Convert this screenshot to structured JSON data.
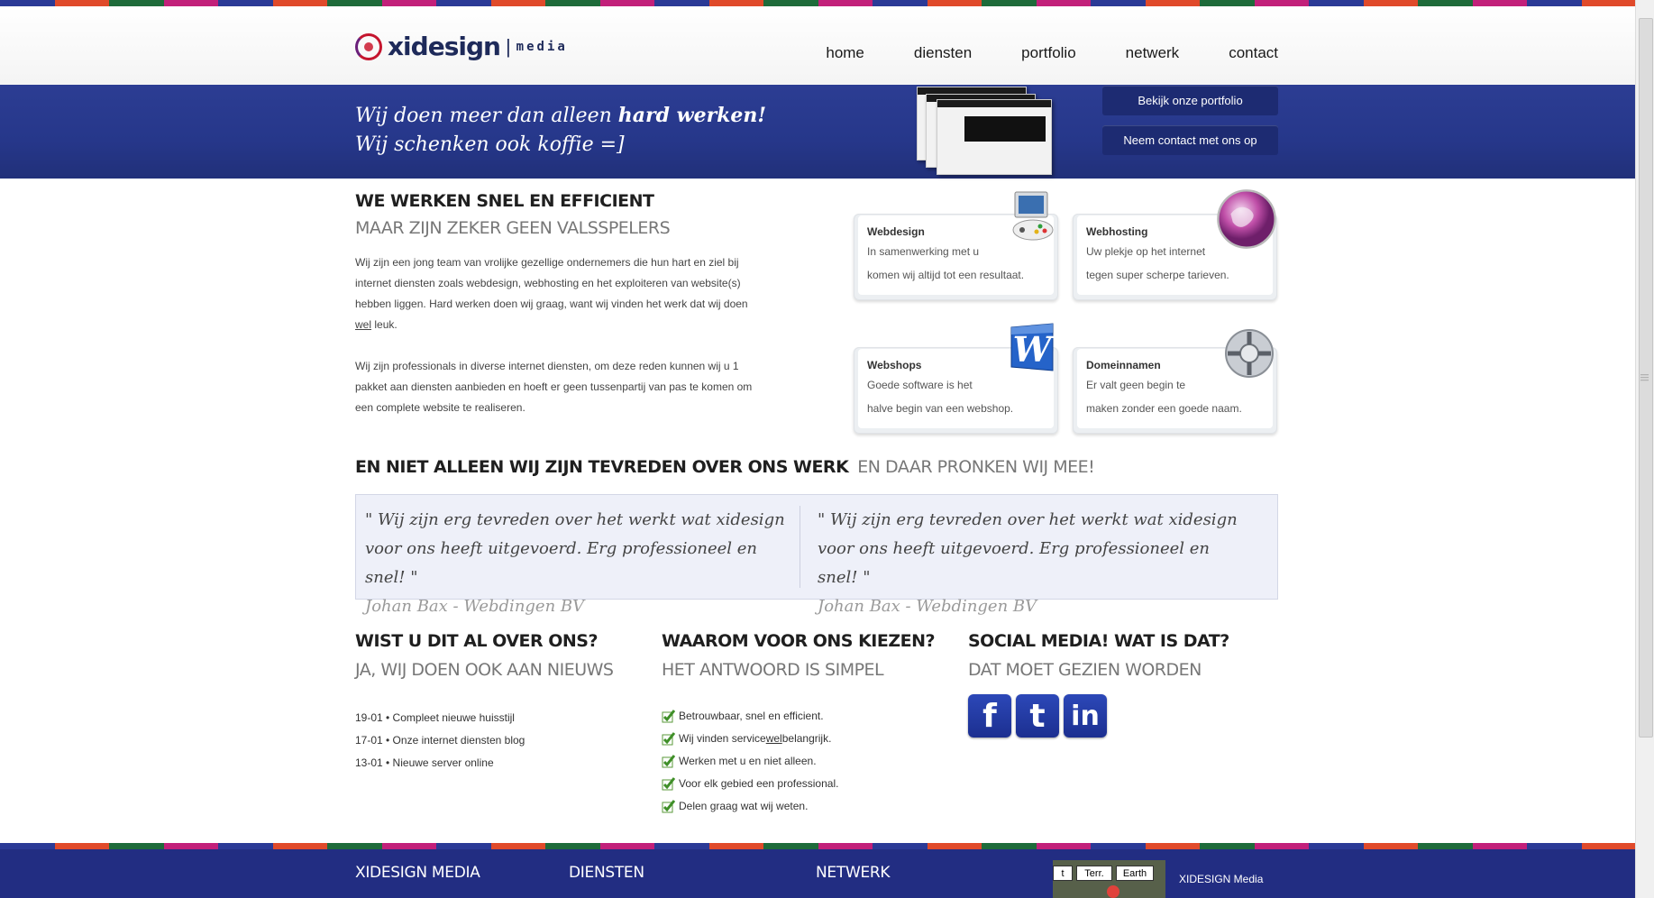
{
  "colors": {
    "brand_blue": "#26378a",
    "button_blue": "#1d2b72",
    "footer_blue": "#222d82",
    "stripe": [
      "#2b3a96",
      "#e04a2a",
      "#1e6b3a",
      "#c2207a",
      "#2b3a96",
      "#e04a2a",
      "#1e6b3a",
      "#c2207a",
      "#2b3a96",
      "#e04a2a",
      "#1e6b3a",
      "#c2207a",
      "#2b3a96",
      "#e04a2a",
      "#1e6b3a",
      "#c2207a",
      "#2b3a96",
      "#e04a2a",
      "#1e6b3a",
      "#c2207a",
      "#2b3a96",
      "#e04a2a",
      "#1e6b3a",
      "#c2207a",
      "#2b3a96",
      "#e04a2a",
      "#1e6b3a",
      "#c2207a",
      "#2b3a96",
      "#e04a2a"
    ]
  },
  "header": {
    "logo_name": "xidesign",
    "logo_sep": "|",
    "logo_sub": "media",
    "nav": [
      "home",
      "diensten",
      "portfolio",
      "netwerk",
      "contact"
    ]
  },
  "banner": {
    "line1_pre": "Wij doen meer dan alleen ",
    "line1_bold": "hard werken!",
    "line2": "Wij schenken ook koffie =]",
    "btn_portfolio": "Bekijk onze portfolio",
    "btn_contact": "Neem contact met ons op"
  },
  "intro": {
    "title": "WE WERKEN SNEL EN EFFICIENT",
    "subtitle": "MAAR ZIJN ZEKER GEEN VALSSPELERS",
    "p1_a": "Wij zijn een jong team van vrolijke gezellige ondernemers die hun hart en ziel bij internet diensten zoals webdesign, webhosting en het exploiteren van website(s) hebben liggen. Hard werken doen wij graag, want wij vinden het werk dat wij doen ",
    "p1_u": "wel",
    "p1_b": " leuk.",
    "p2": "Wij zijn professionals in diverse internet diensten, om deze reden kunnen wij u 1 pakket aan diensten aanbieden en hoeft er geen tussenpartij van pas te komen om een complete website te realiseren."
  },
  "services": [
    {
      "title": "Webdesign",
      "line1": "In samenwerking met u",
      "line2": "komen wij altijd tot een resultaat.",
      "icon": "gamepad-monitor-icon"
    },
    {
      "title": "Webhosting",
      "line1": "Uw plekje op het internet",
      "line2": "tegen super scherpe tarieven.",
      "icon": "globe-icon"
    },
    {
      "title": "Webshops",
      "line1": "Goede software is het",
      "line2": "halve begin van een webshop.",
      "icon": "word-w-icon"
    },
    {
      "title": "Domeinnamen",
      "line1": "Er valt geen begin te",
      "line2": "maken zonder een goede naam.",
      "icon": "network-hub-icon"
    }
  ],
  "testimonials": {
    "title": "EN NIET ALLEEN WIJ ZIJN TEVREDEN OVER ONS WERK",
    "subtitle": "EN DAAR PRONKEN WIJ MEE!",
    "items": [
      {
        "text": "\" Wij zijn erg tevreden over het werkt wat xidesign voor ons heeft uitgevoerd. Erg professioneel en snel! \"",
        "by": "Johan Bax - Webdingen BV"
      },
      {
        "text": "\" Wij zijn erg tevreden over het werkt wat xidesign voor ons heeft uitgevoerd. Erg professioneel en snel! \"",
        "by": "Johan Bax - Webdingen BV"
      }
    ]
  },
  "news": {
    "title": "WIST U DIT AL OVER ONS?",
    "subtitle": "JA, WIJ DOEN OOK AAN NIEUWS",
    "items": [
      "19-01 • Compleet nieuwe huisstijl",
      "17-01 • Onze internet diensten blog",
      "13-01 • Nieuwe server online"
    ]
  },
  "why": {
    "title": "WAAROM VOOR ONS KIEZEN?",
    "subtitle": "HET ANTWOORD IS SIMPEL",
    "item1": "Betrouwbaar, snel en efficient.",
    "item2_a": "Wij vinden service ",
    "item2_u": "wel",
    "item2_b": " belangrijk.",
    "item3": "Werken met u en niet alleen.",
    "item4": "Voor elk gebied een professional.",
    "item5": "Delen graag wat wij weten."
  },
  "social": {
    "title": "SOCIAL MEDIA! WAT IS DAT?",
    "subtitle": "DAT MOET GEZIEN WORDEN",
    "facebook": "f",
    "twitter": "t",
    "linkedin": "in"
  },
  "footer": {
    "col1": "XIDESIGN MEDIA",
    "col2": "DIENSTEN",
    "col3": "NETWERK",
    "map_btn1": "t",
    "map_btn2": "Terr.",
    "map_btn3": "Earth",
    "address_name": "XIDESIGN Media"
  }
}
